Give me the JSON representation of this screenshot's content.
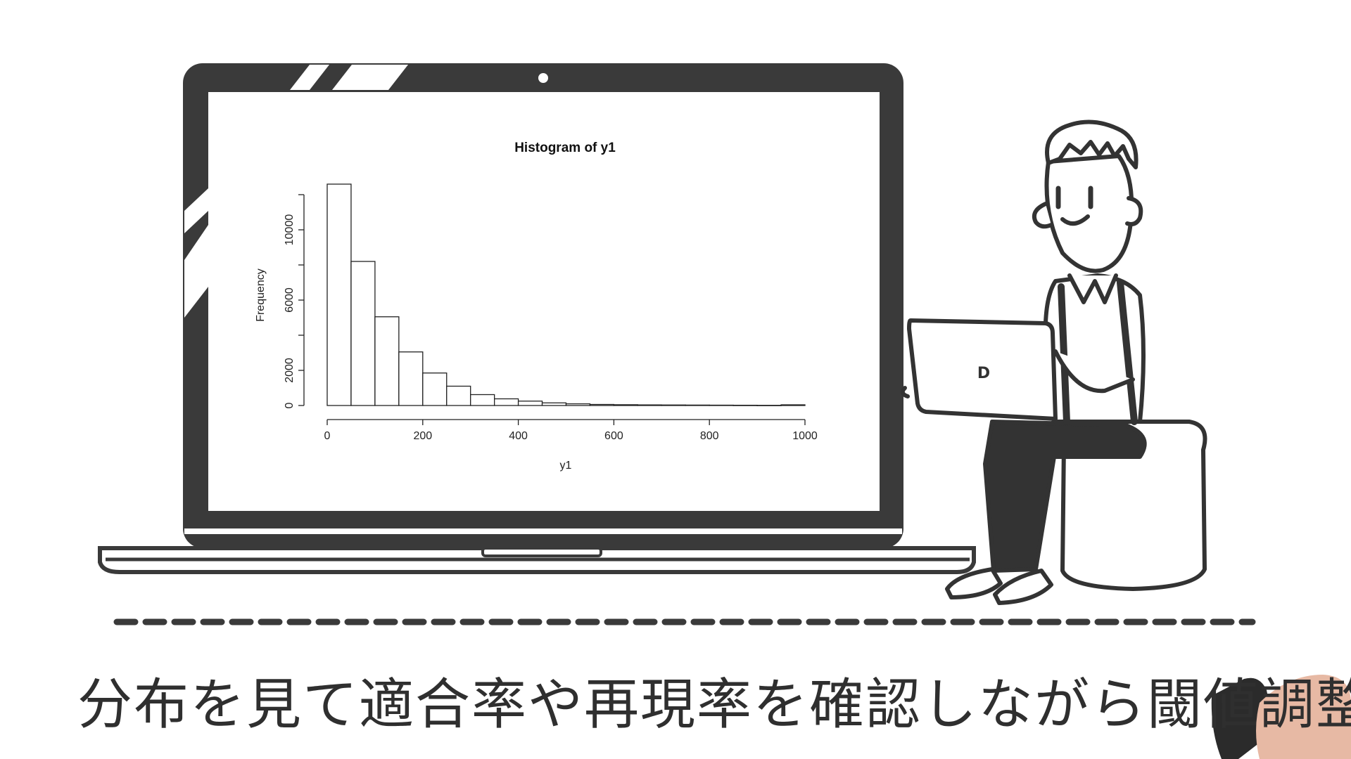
{
  "caption": "分布を見て適合率や再現率を確認しながら閾値調整",
  "laptop_logo": "D",
  "colors": {
    "ink": "#3a3a3a",
    "paper": "#ffffff"
  },
  "chart_data": {
    "type": "bar",
    "title": "Histogram of y1",
    "xlabel": "y1",
    "ylabel": "Frequency",
    "bin_edges": [
      0,
      50,
      100,
      150,
      200,
      250,
      300,
      350,
      400,
      450,
      500,
      550,
      600,
      650,
      700,
      750,
      800,
      850,
      900,
      950,
      1000
    ],
    "values": [
      12600,
      8200,
      5050,
      3050,
      1850,
      1100,
      620,
      380,
      250,
      150,
      95,
      60,
      45,
      35,
      30,
      25,
      20,
      15,
      10,
      40
    ],
    "xlim": [
      0,
      1000
    ],
    "ylim": [
      0,
      12600
    ],
    "xticks": [
      "0",
      "200",
      "400",
      "600",
      "800",
      "1000"
    ],
    "yticks": [
      "0",
      "2000",
      "6000",
      "10000"
    ],
    "grid": false,
    "legend": "none"
  }
}
